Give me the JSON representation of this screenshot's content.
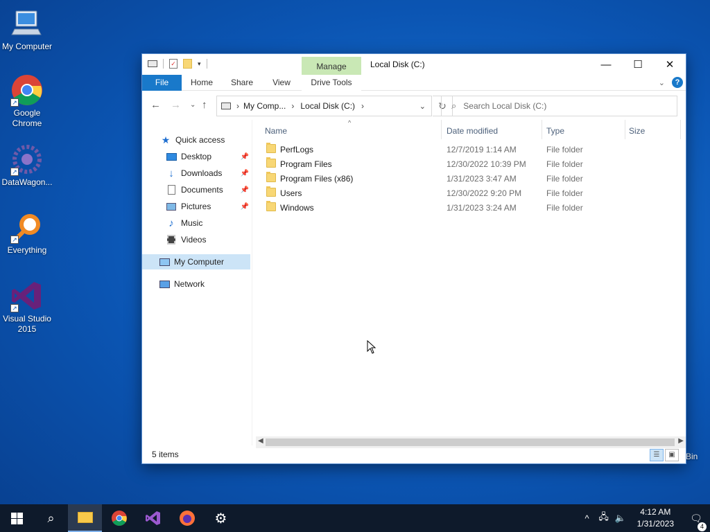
{
  "desktop": {
    "icons": [
      {
        "label": "My Computer"
      },
      {
        "label": "Google Chrome"
      },
      {
        "label": "DataWagon..."
      },
      {
        "label": "Everything"
      },
      {
        "label": "Visual Studio 2015"
      }
    ],
    "recycle_partial": "Bin"
  },
  "window": {
    "title": "Local Disk (C:)",
    "context_tab": "Manage",
    "ribbon_tabs": [
      "File",
      "Home",
      "Share",
      "View",
      "Drive Tools"
    ],
    "breadcrumb": [
      "My Comp...",
      "Local Disk (C:)"
    ],
    "search_placeholder": "Search Local Disk (C:)",
    "nav": {
      "quick_access": "Quick access",
      "items": [
        "Desktop",
        "Downloads",
        "Documents",
        "Pictures",
        "Music",
        "Videos"
      ],
      "this_pc": "My Computer",
      "network": "Network"
    },
    "columns": [
      "Name",
      "Date modified",
      "Type",
      "Size"
    ],
    "files": [
      {
        "name": "PerfLogs",
        "date": "12/7/2019 1:14 AM",
        "type": "File folder"
      },
      {
        "name": "Program Files",
        "date": "12/30/2022 10:39 PM",
        "type": "File folder"
      },
      {
        "name": "Program Files (x86)",
        "date": "1/31/2023 3:47 AM",
        "type": "File folder"
      },
      {
        "name": "Users",
        "date": "12/30/2022 9:20 PM",
        "type": "File folder"
      },
      {
        "name": "Windows",
        "date": "1/31/2023 3:24 AM",
        "type": "File folder"
      }
    ],
    "status": "5 items"
  },
  "taskbar": {
    "time": "4:12 AM",
    "date": "1/31/2023",
    "notification_count": "4"
  }
}
